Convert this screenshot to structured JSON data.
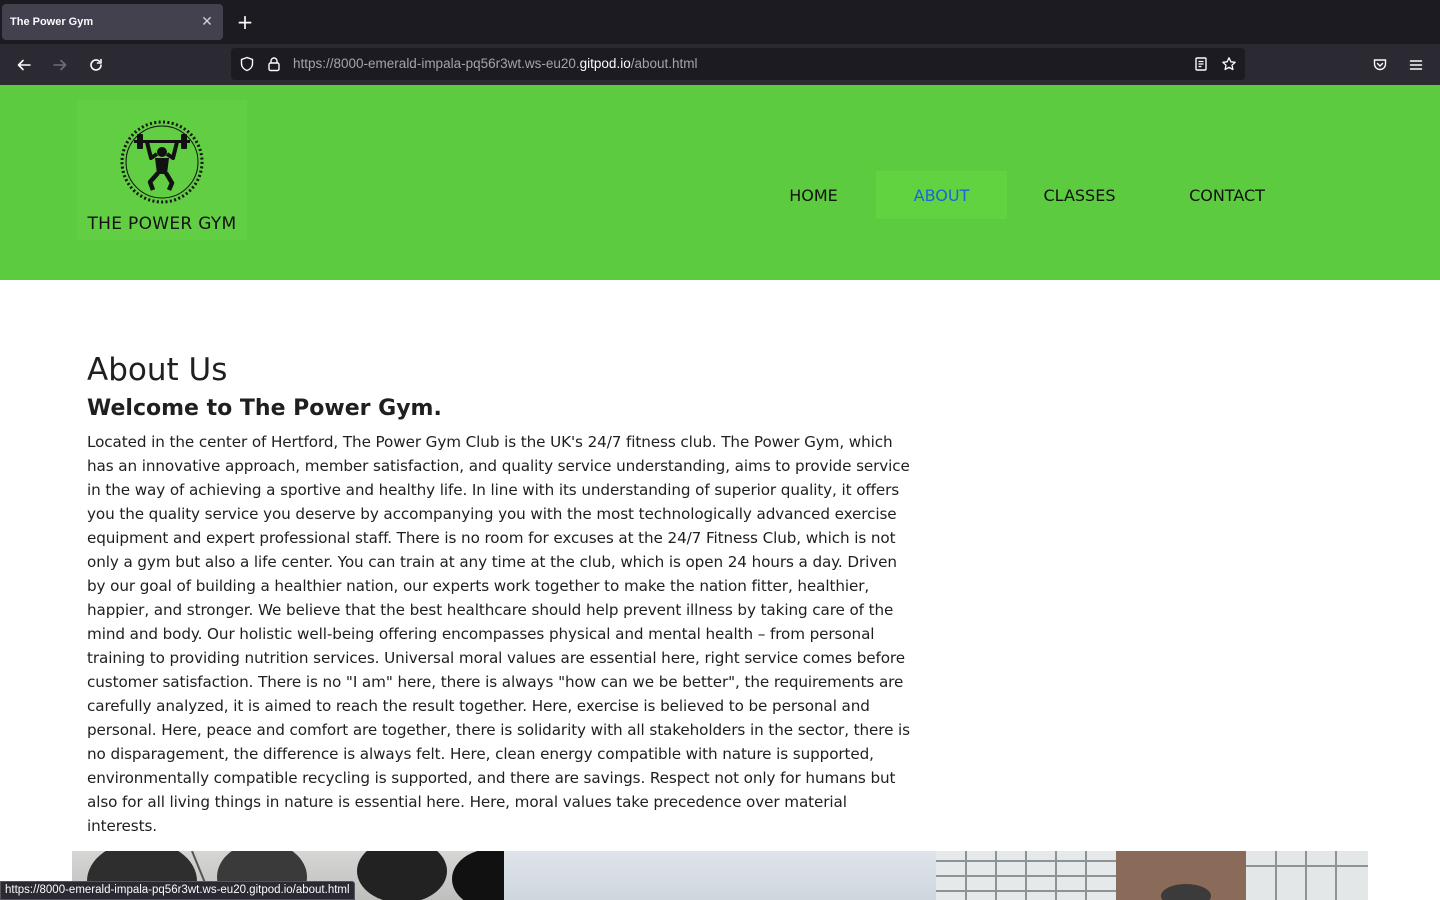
{
  "browser": {
    "tab_title": "The Power Gym",
    "url_prefix": "https://8000-emerald-impala-pq56r3wt.ws-eu20.",
    "url_host": "gitpod.io",
    "url_path": "/about.html",
    "status_url": "https://8000-emerald-impala-pq56r3wt.ws-eu20.gitpod.io/about.html"
  },
  "site": {
    "logo_text": "THE POWER GYM",
    "header_color": "#5dcb40",
    "nav": [
      {
        "label": "HOME",
        "active": false
      },
      {
        "label": "ABOUT",
        "active": true
      },
      {
        "label": "CLASSES",
        "active": false
      },
      {
        "label": "CONTACT",
        "active": false
      }
    ],
    "active_link_color": "#1a66d8"
  },
  "main": {
    "title": "About Us",
    "subtitle": "Welcome to The Power Gym.",
    "body": "Located in the center of Hertford, The Power Gym Club is the UK's 24/7 fitness club. The Power Gym, which has an innovative approach, member satisfaction, and quality service understanding, aims to provide service in the way of achieving a sportive and healthy life. In line with its understanding of superior quality, it offers you the quality service you deserve by accompanying you with the most technologically advanced exercise equipment and expert professional staff. There is no room for excuses at the 24/7 Fitness Club, which is not only a gym but also a life center. You can train at any time at the club, which is open 24 hours a day. Driven by our goal of building a healthier nation, our experts work together to make the nation fitter, healthier, happier, and stronger. We believe that the best healthcare should help prevent illness by taking care of the mind and body. Our holistic well-being offering encompasses physical and mental health – from personal training to providing nutrition services. Universal moral values are essential here, right service comes before customer satisfaction. There is no \"I am\" here, there is always \"how can we be better\", the requirements are carefully analyzed, it is aimed to reach the result together. Here, exercise is believed to be personal and personal. Here, peace and comfort are together, there is solidarity with all stakeholders in the sector, there is no disparagement, the difference is always felt. Here, clean energy compatible with nature is supported, environmentally compatible recycling is supported, and there are savings. Respect not only for humans but also for all living things in nature is essential here. Here, moral values take precedence over material interests."
  }
}
